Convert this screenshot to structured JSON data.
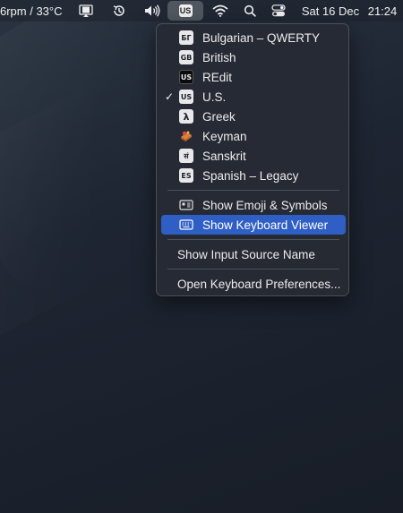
{
  "menubar": {
    "weather_text": "6rpm / 33°C",
    "input_source_badge": "US",
    "date": "Sat 16 Dec",
    "time": "21:24",
    "icons": [
      "display-icon",
      "time-machine-icon",
      "volume-icon",
      "input-source-icon",
      "wifi-icon",
      "spotlight-icon",
      "control-center-icon"
    ]
  },
  "menu": {
    "sources": [
      {
        "badge": "БГ",
        "label": "Bulgarian – QWERTY",
        "checked": false
      },
      {
        "badge": "GB",
        "label": "British",
        "checked": false
      },
      {
        "badge": "US",
        "label": "REdit",
        "checked": false
      },
      {
        "badge": "US",
        "label": "U.S.",
        "checked": true
      },
      {
        "badge": "λ",
        "label": "Greek",
        "checked": false
      },
      {
        "badge": "keyman",
        "label": "Keyman",
        "checked": false
      },
      {
        "badge": "सं",
        "label": "Sanskrit",
        "checked": false
      },
      {
        "badge": "ES",
        "label": "Spanish – Legacy",
        "checked": false
      }
    ],
    "check_mark": "✓",
    "actions": {
      "emoji": "Show Emoji & Symbols",
      "keyboard_viewer": "Show Keyboard Viewer",
      "input_source_name": "Show Input Source Name",
      "preferences": "Open Keyboard Preferences..."
    },
    "highlight_color": "#2f5fc4"
  }
}
